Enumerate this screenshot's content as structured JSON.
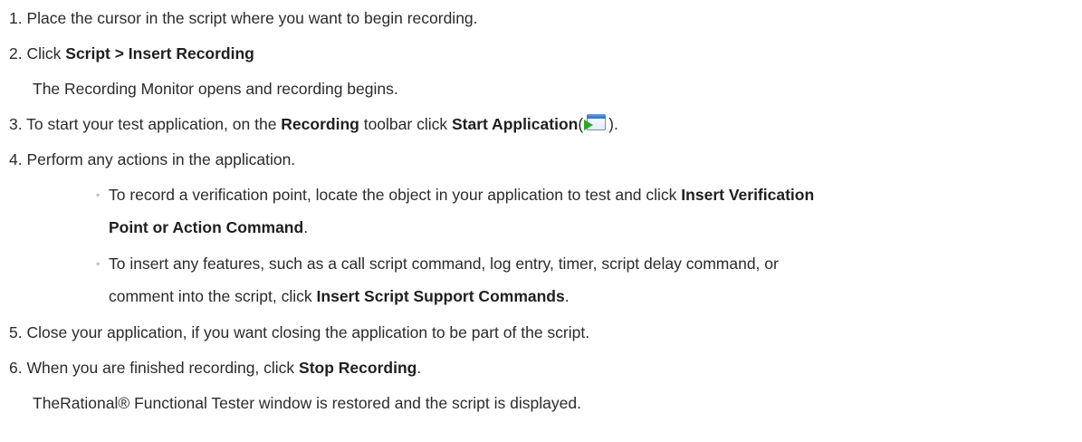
{
  "steps": [
    {
      "number": "1.",
      "text": "Place the cursor in the script where you want to begin recording."
    },
    {
      "number": "2.",
      "pre": "Click ",
      "bold": "Script > Insert Recording",
      "note": "The Recording Monitor opens and recording begins."
    },
    {
      "number": "3.",
      "pre": "To start your test application, on the ",
      "bold1": "Recording",
      "mid": " toolbar click ",
      "bold2": "Start Application",
      "paren_open": "(",
      "icon": "start-application-icon",
      "paren_close": ")."
    },
    {
      "number": "4.",
      "text": "Perform any actions in the application.",
      "subitems": [
        {
          "bullet": "◦",
          "line1_pre": "To record a verification point, locate the object in your application to test and click ",
          "line1_bold": "Insert Verification",
          "line2_bold": "Point or Action Command",
          "line2_post": "."
        },
        {
          "bullet": "◦",
          "line1": "To insert any features, such as a call script command, log entry, timer, script delay command, or",
          "line2_pre": "comment into the script, click ",
          "line2_bold": "Insert Script Support Commands",
          "line2_post": "."
        }
      ]
    },
    {
      "number": "5.",
      "text": "Close your application, if you want closing the application to be part of the script."
    },
    {
      "number": "6.",
      "pre": "When you are finished recording, click ",
      "bold": "Stop Recording",
      "post": ".",
      "note": "TheRational® Functional Tester window is restored and the script is displayed."
    }
  ]
}
